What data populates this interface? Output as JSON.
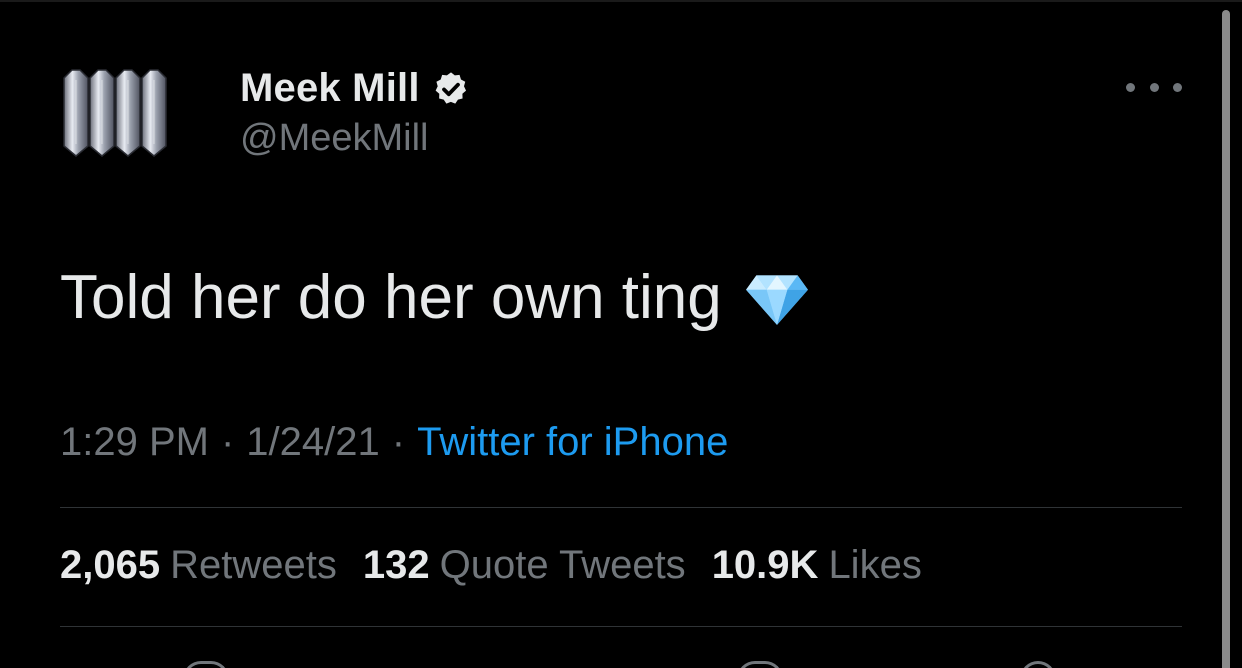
{
  "user": {
    "name": "Meek Mill",
    "handle": "@MeekMill",
    "verified": true
  },
  "tweet": {
    "text": "Told her do her own ting",
    "emoji_icon": "gem-icon"
  },
  "meta": {
    "time": "1:29 PM",
    "separator": "·",
    "date": "1/24/21",
    "source": "Twitter for iPhone"
  },
  "stats": {
    "retweets_count": "2,065",
    "retweets_label": "Retweets",
    "quotes_count": "132",
    "quotes_label": "Quote Tweets",
    "likes_count": "10.9K",
    "likes_label": "Likes"
  },
  "colors": {
    "background": "#000000",
    "text": "#e7e9ea",
    "muted": "#71767b",
    "link": "#1d9bf0",
    "divider": "#2f3336"
  }
}
